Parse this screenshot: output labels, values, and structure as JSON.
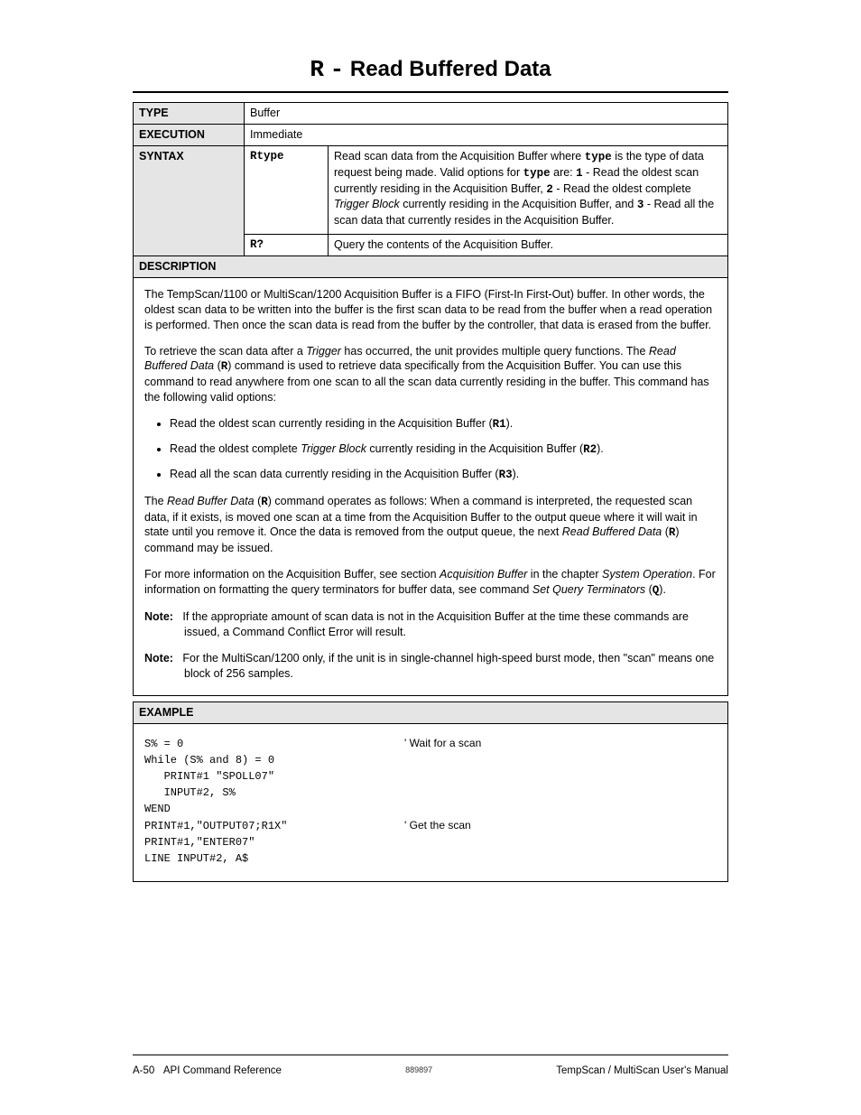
{
  "title": {
    "command_letter": "R",
    "dash": "-",
    "heading": "Read Buffered Data"
  },
  "table": {
    "type_label": "TYPE",
    "type_value": "Buffer",
    "execution_label": "EXECUTION",
    "execution_value": "Immediate",
    "syntax_label": "SYNTAX",
    "syntax1_cmd": "Rtype",
    "syntax1_desc_parts": {
      "a": "Read scan data from the Acquisition Buffer where ",
      "b": "type",
      "c": " is the type of data request being made.  Valid options for ",
      "d": "type",
      "e": " are: ",
      "f": "1",
      "g": " - Read the oldest scan currently residing in the Acquisition Buffer, ",
      "h": "2",
      "i": " - Read the oldest complete ",
      "j": "Trigger Block",
      "k": " currently residing in the Acquisition Buffer, and ",
      "l": "3",
      "m": " - Read all the scan data that currently resides in the Acquisition Buffer."
    },
    "syntax2_cmd": "R?",
    "syntax2_desc": "Query the contents of the Acquisition Buffer.",
    "description_label": "DESCRIPTION"
  },
  "desc": {
    "p1": "The TempScan/1100 or MultiScan/1200 Acquisition Buffer is a FIFO (First-In First-Out) buffer.  In other words, the oldest scan data to be written into the buffer is the first scan data to be read from the buffer when a read operation is performed.  Then once the scan data is read from the buffer by the controller, that data is erased from the buffer.",
    "p2_parts": {
      "a": "To retrieve the scan data after a ",
      "b": "Trigger",
      "c": " has occurred, the unit provides multiple query functions.  The ",
      "d": "Read Buffered Data",
      "e": " (",
      "f": "R",
      "g": ") command is used to retrieve data specifically from the Acquisition Buffer.  You can use this command to read anywhere from one scan to all the scan data currently residing in the buffer.  This command has the following valid options:"
    },
    "b1": {
      "a": "Read the oldest scan currently residing in the Acquisition Buffer (",
      "b": "R1",
      "c": ")."
    },
    "b2": {
      "a": "Read the oldest complete ",
      "b": "Trigger Block",
      "c": " currently residing in the Acquisition Buffer (",
      "d": "R2",
      "e": ")."
    },
    "b3": {
      "a": "Read all the scan data currently residing in the Acquisition Buffer (",
      "b": "R3",
      "c": ")."
    },
    "p3_parts": {
      "a": "The ",
      "b": "Read Buffer Data",
      "c": " (",
      "d": "R",
      "e": ") command operates as follows: When a command is interpreted, the requested scan data, if it exists, is moved one scan at a time from the Acquisition Buffer to the output queue where it will wait in state until you remove it.  Once the data is removed from the output queue, the next ",
      "f": "Read Buffered Data",
      "g": " (",
      "h": "R",
      "i": ") command may be issued."
    },
    "p4_parts": {
      "a": "For more information on the Acquisition Buffer, see section ",
      "b": "Acquisition Buffer",
      "c": " in the chapter ",
      "d": "System Operation",
      "e": ".  For information on formatting the query terminators for buffer data, see command ",
      "f": "Set Query Terminators",
      "g": " (",
      "h": "Q",
      "i": ")."
    },
    "note1_label": "Note:",
    "note1_text": "If the appropriate amount of scan data is not in the Acquisition Buffer at the time these commands are issued, a Command Conflict Error will result.",
    "note2_label": "Note:",
    "note2_text": "For the MultiScan/1200 only, if the unit is in single-channel high-speed burst mode, then \"scan\" means one block of 256 samples."
  },
  "example": {
    "label": "EXAMPLE",
    "lines": [
      {
        "code": "S% = 0",
        "comment": "' Wait for a scan"
      },
      {
        "code": "While (S% and 8) = 0",
        "comment": ""
      },
      {
        "code": "   PRINT#1 \"SPOLL07\"",
        "comment": ""
      },
      {
        "code": "   INPUT#2, S%",
        "comment": ""
      },
      {
        "code": "WEND",
        "comment": ""
      },
      {
        "code": "PRINT#1,\"OUTPUT07;R1X\"",
        "comment": "' Get the scan"
      },
      {
        "code": "PRINT#1,\"ENTER07\"",
        "comment": ""
      },
      {
        "code": "LINE INPUT#2, A$",
        "comment": ""
      }
    ]
  },
  "footer": {
    "left_page": "A-50",
    "left_section": "API Command Reference",
    "center": "889897",
    "right": "TempScan / MultiScan User's Manual"
  }
}
